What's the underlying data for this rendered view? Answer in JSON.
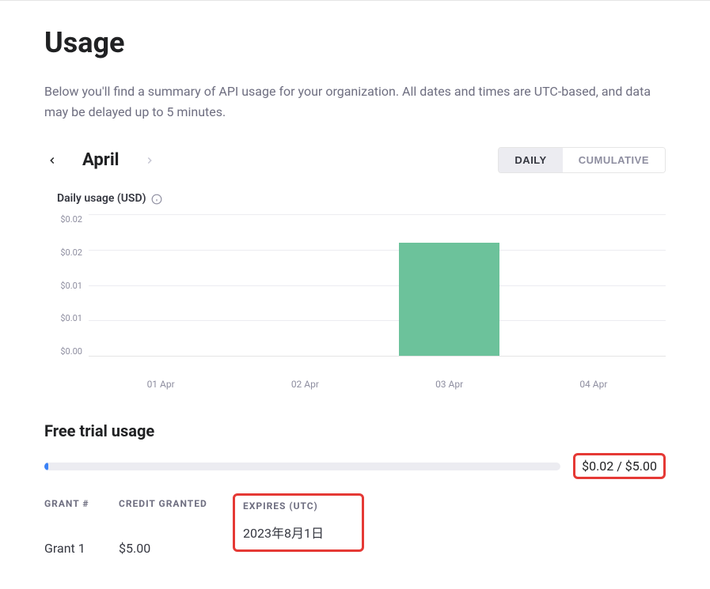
{
  "page": {
    "title": "Usage",
    "description": "Below you'll find a summary of API usage for your organization. All dates and times are UTC-based, and data may be delayed up to 5 minutes."
  },
  "month_nav": {
    "month": "April"
  },
  "toggle": {
    "daily": "DAILY",
    "cumulative": "CUMULATIVE"
  },
  "chart": {
    "title": "Daily usage (USD)"
  },
  "chart_data": {
    "type": "bar",
    "title": "Daily usage (USD)",
    "xlabel": "",
    "ylabel": "USD",
    "ylim": [
      0.0,
      0.02
    ],
    "y_ticks": [
      "$0.02",
      "$0.02",
      "$0.01",
      "$0.01",
      "$0.00"
    ],
    "categories": [
      "01 Apr",
      "02 Apr",
      "03 Apr",
      "04 Apr"
    ],
    "values": [
      0.0,
      0.0,
      0.016,
      0.0
    ]
  },
  "free_trial": {
    "title": "Free trial usage",
    "used": "$0.02",
    "total": "$5.00",
    "display": "$0.02 / $5.00",
    "progress_pct": 0.4
  },
  "grants": {
    "headers": {
      "grant": "GRANT #",
      "credit": "CREDIT GRANTED",
      "expires": "EXPIRES (UTC)"
    },
    "rows": [
      {
        "grant": "Grant 1",
        "credit": "$5.00",
        "expires": "2023年8月1日"
      }
    ]
  }
}
